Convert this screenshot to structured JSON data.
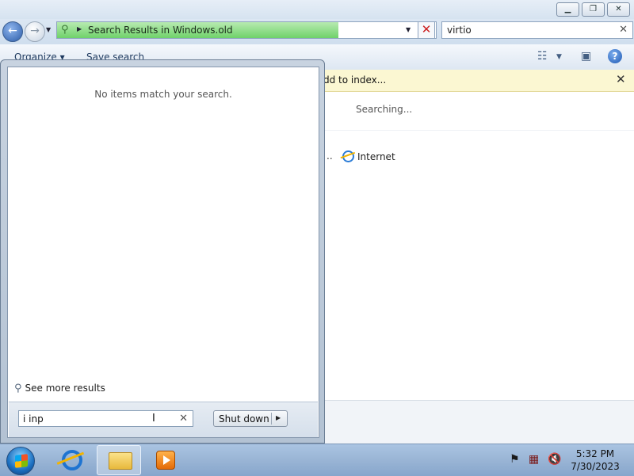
{
  "window": {
    "address": "Search Results in Windows.old",
    "search_value": "virtio",
    "info_bar": "dd to index...",
    "searching": "Searching...",
    "partial_item": "..",
    "again_item": "Internet"
  },
  "toolbar": {
    "organize": "Organize ▾",
    "save_search": "Save search"
  },
  "start_menu": {
    "no_items": "No items match your search.",
    "see_more": "See more results",
    "search_value": "i inp",
    "shutdown_label": "Shut down"
  },
  "taskbar": {
    "time": "5:32 PM",
    "date": "7/30/2023"
  },
  "colors": {
    "address_progress": "#6fd26a",
    "info_bar": "#fbf7d2",
    "taskbar": "#9bb6d6"
  }
}
